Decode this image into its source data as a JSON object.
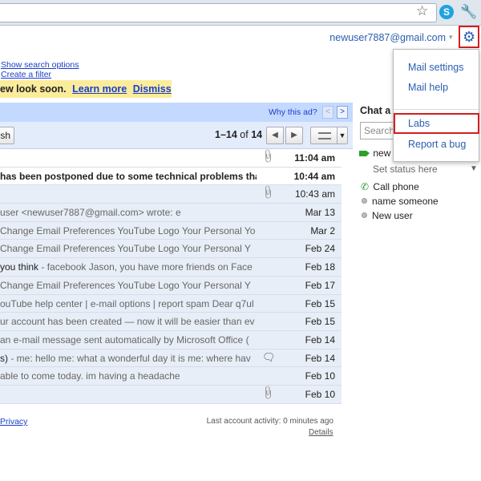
{
  "browser": {
    "icons": [
      "star-icon",
      "skype-icon",
      "wrench-icon"
    ],
    "skype_glyph": "S",
    "star_glyph": "☆",
    "wrench_glyph": "🔧"
  },
  "header": {
    "user_email": "newuser7887@gmail.com",
    "user_caret": "▾",
    "gear_glyph": "⚙"
  },
  "search_links": {
    "show_options": "Show search options",
    "create_filter": "Create a filter"
  },
  "notice": {
    "text": "ew look soon.",
    "learn_more": "Learn more",
    "dismiss": "Dismiss"
  },
  "ad_bar": {
    "why_ad": "Why this ad?",
    "prev": "<",
    "next": ">"
  },
  "toolbar": {
    "refresh_label": "sh",
    "range": "1–14",
    "of_label": "of",
    "total": "14",
    "prev_glyph": "◀",
    "next_glyph": "▶",
    "view_caret": "▼"
  },
  "emails": [
    {
      "snippet_subject": "",
      "snippet_body": "",
      "date": "11:04 am",
      "unread": true,
      "icon": "attach"
    },
    {
      "snippet_subject": "has been postponed due to some technical problems that w",
      "snippet_body": "",
      "date": "10:44 am",
      "unread": true,
      "icon": ""
    },
    {
      "snippet_subject": "",
      "snippet_body": "",
      "date": "10:43 am",
      "unread": false,
      "icon": "attach"
    },
    {
      "snippet_subject": "",
      "snippet_body": "user <newuser7887@gmail.com> wrote: e",
      "date": "Mar 13",
      "unread": false,
      "icon": ""
    },
    {
      "snippet_subject": "",
      "snippet_body": "Change Email Preferences YouTube Logo Your Personal Yo",
      "date": "Mar 2",
      "unread": false,
      "icon": ""
    },
    {
      "snippet_subject": "",
      "snippet_body": "Change Email Preferences YouTube Logo Your Personal Y",
      "date": "Feb 24",
      "unread": false,
      "icon": ""
    },
    {
      "snippet_subject": "you think",
      "snippet_body": " - facebook Jason, you have more friends on Face",
      "date": "Feb 18",
      "unread": false,
      "icon": ""
    },
    {
      "snippet_subject": "",
      "snippet_body": "Change Email Preferences YouTube Logo Your Personal Y",
      "date": "Feb 17",
      "unread": false,
      "icon": ""
    },
    {
      "snippet_subject": "",
      "snippet_body": "ouTube help center | e-mail options | report spam Dear q7ul",
      "date": "Feb 15",
      "unread": false,
      "icon": ""
    },
    {
      "snippet_subject": "",
      "snippet_body": "ur account has been created — now it will be easier than ev",
      "date": "Feb 15",
      "unread": false,
      "icon": ""
    },
    {
      "snippet_subject": "",
      "snippet_body": "an e-mail message sent automatically by Microsoft Office (",
      "date": "Feb 14",
      "unread": false,
      "icon": ""
    },
    {
      "snippet_subject": "s)",
      "snippet_body": " - me: hello me: what a wonderful day it is me: where hav",
      "date": "Feb 14",
      "unread": false,
      "icon": "chat"
    },
    {
      "snippet_subject": "",
      "snippet_body": " able to come today. im having a headache",
      "date": "Feb 10",
      "unread": false,
      "icon": ""
    },
    {
      "snippet_subject": "",
      "snippet_body": "",
      "date": "Feb 10",
      "unread": false,
      "icon": "attach"
    }
  ],
  "footer": {
    "privacy": "Privacy",
    "last_activity": "Last account activity: 0 minutes ago",
    "details": "Details"
  },
  "chat": {
    "title": "Chat a",
    "search_placeholder": "Search",
    "me_name": "new",
    "status": "Set status here",
    "status_caret": "▼",
    "call_phone": "Call phone",
    "phone_glyph": "✆",
    "contacts": [
      "name someone",
      "New user"
    ]
  },
  "settings_menu": {
    "mail_settings": "Mail settings",
    "mail_help": "Mail help",
    "labs": "Labs",
    "report_bug": "Report a bug"
  },
  "colors": {
    "accent_blue": "#2a5db0",
    "highlight_red": "#d21f1f",
    "notice_yellow": "#fbec9c",
    "ad_bar_blue": "#c3d9ff",
    "read_row": "#e8eef7"
  }
}
